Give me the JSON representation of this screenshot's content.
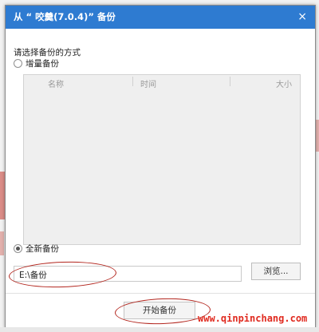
{
  "dialog": {
    "title": "从 “ 咬羹(7.0.4)” 备份",
    "close_glyph": "×"
  },
  "prompt": "请选择备份的方式",
  "options": {
    "incremental": {
      "label": "增量备份",
      "selected": false
    },
    "full": {
      "label": "全新备份",
      "selected": true
    }
  },
  "table": {
    "columns": [
      "名称",
      "时间",
      "大小"
    ],
    "rows": []
  },
  "path": {
    "value": "E:\\备份"
  },
  "buttons": {
    "browse": "浏览...",
    "start": "开始备份"
  },
  "watermark": "www.qinpinchang.com",
  "colors": {
    "titlebar": "#2e7bd1",
    "annotation": "#b3261e"
  },
  "icons": {
    "close": "close-icon"
  }
}
